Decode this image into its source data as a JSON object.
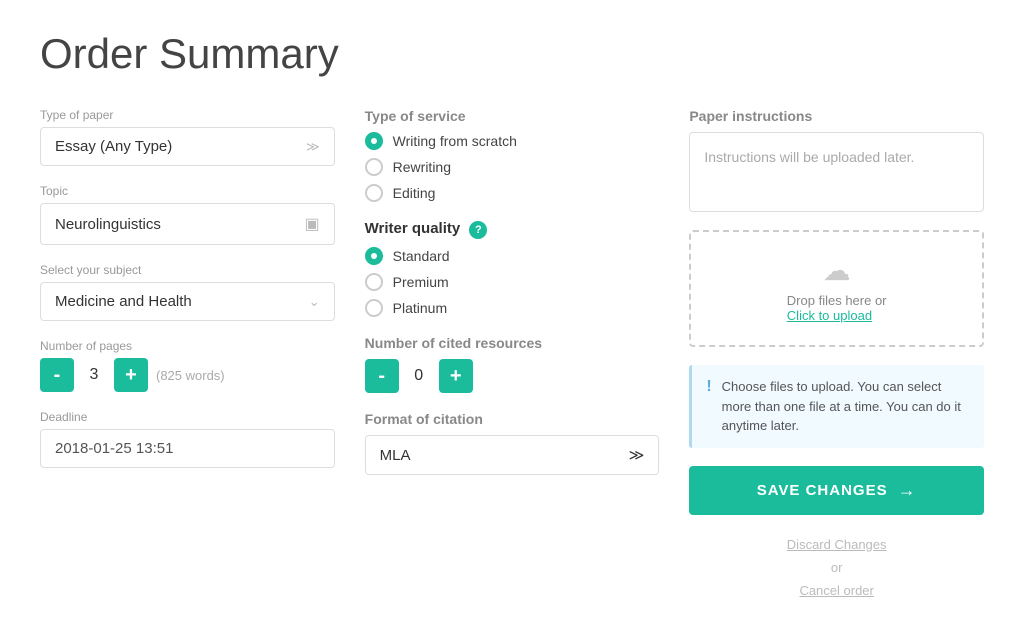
{
  "page": {
    "title": "Order Summary"
  },
  "col1": {
    "type_of_paper_label": "Type of paper",
    "type_of_paper_value": "Essay (Any Type)",
    "topic_label": "Topic",
    "topic_value": "Neurolinguistics",
    "subject_label": "Select your subject",
    "subject_value": "Medicine and Health",
    "pages_label": "Number of pages",
    "pages_value": "3",
    "pages_words": "(825 words)",
    "deadline_label": "Deadline",
    "deadline_value": "2018-01-25 13:51",
    "minus_label": "-",
    "plus_label": "+"
  },
  "col2": {
    "service_label": "Type of service",
    "service_options": [
      {
        "label": "Writing from scratch",
        "selected": true
      },
      {
        "label": "Rewriting",
        "selected": false
      },
      {
        "label": "Editing",
        "selected": false
      }
    ],
    "quality_label": "Writer quality",
    "quality_options": [
      {
        "label": "Standard",
        "selected": true
      },
      {
        "label": "Premium",
        "selected": false
      },
      {
        "label": "Platinum",
        "selected": false
      }
    ],
    "cited_label": "Number of cited resources",
    "cited_value": "0",
    "cited_minus": "-",
    "cited_plus": "+",
    "citation_label": "Format of citation",
    "citation_value": "MLA"
  },
  "col3": {
    "instructions_label": "Paper instructions",
    "instructions_placeholder": "Instructions will be uploaded later.",
    "upload_text_1": "Drop files here or",
    "upload_text_2": "Click to upload",
    "info_text": "Choose files to upload. You can select more than one file at a time. You can do it anytime later.",
    "save_label": "SAVE CHANGES",
    "discard_label": "Discard Changes",
    "or_label": "or",
    "cancel_label": "Cancel order"
  }
}
